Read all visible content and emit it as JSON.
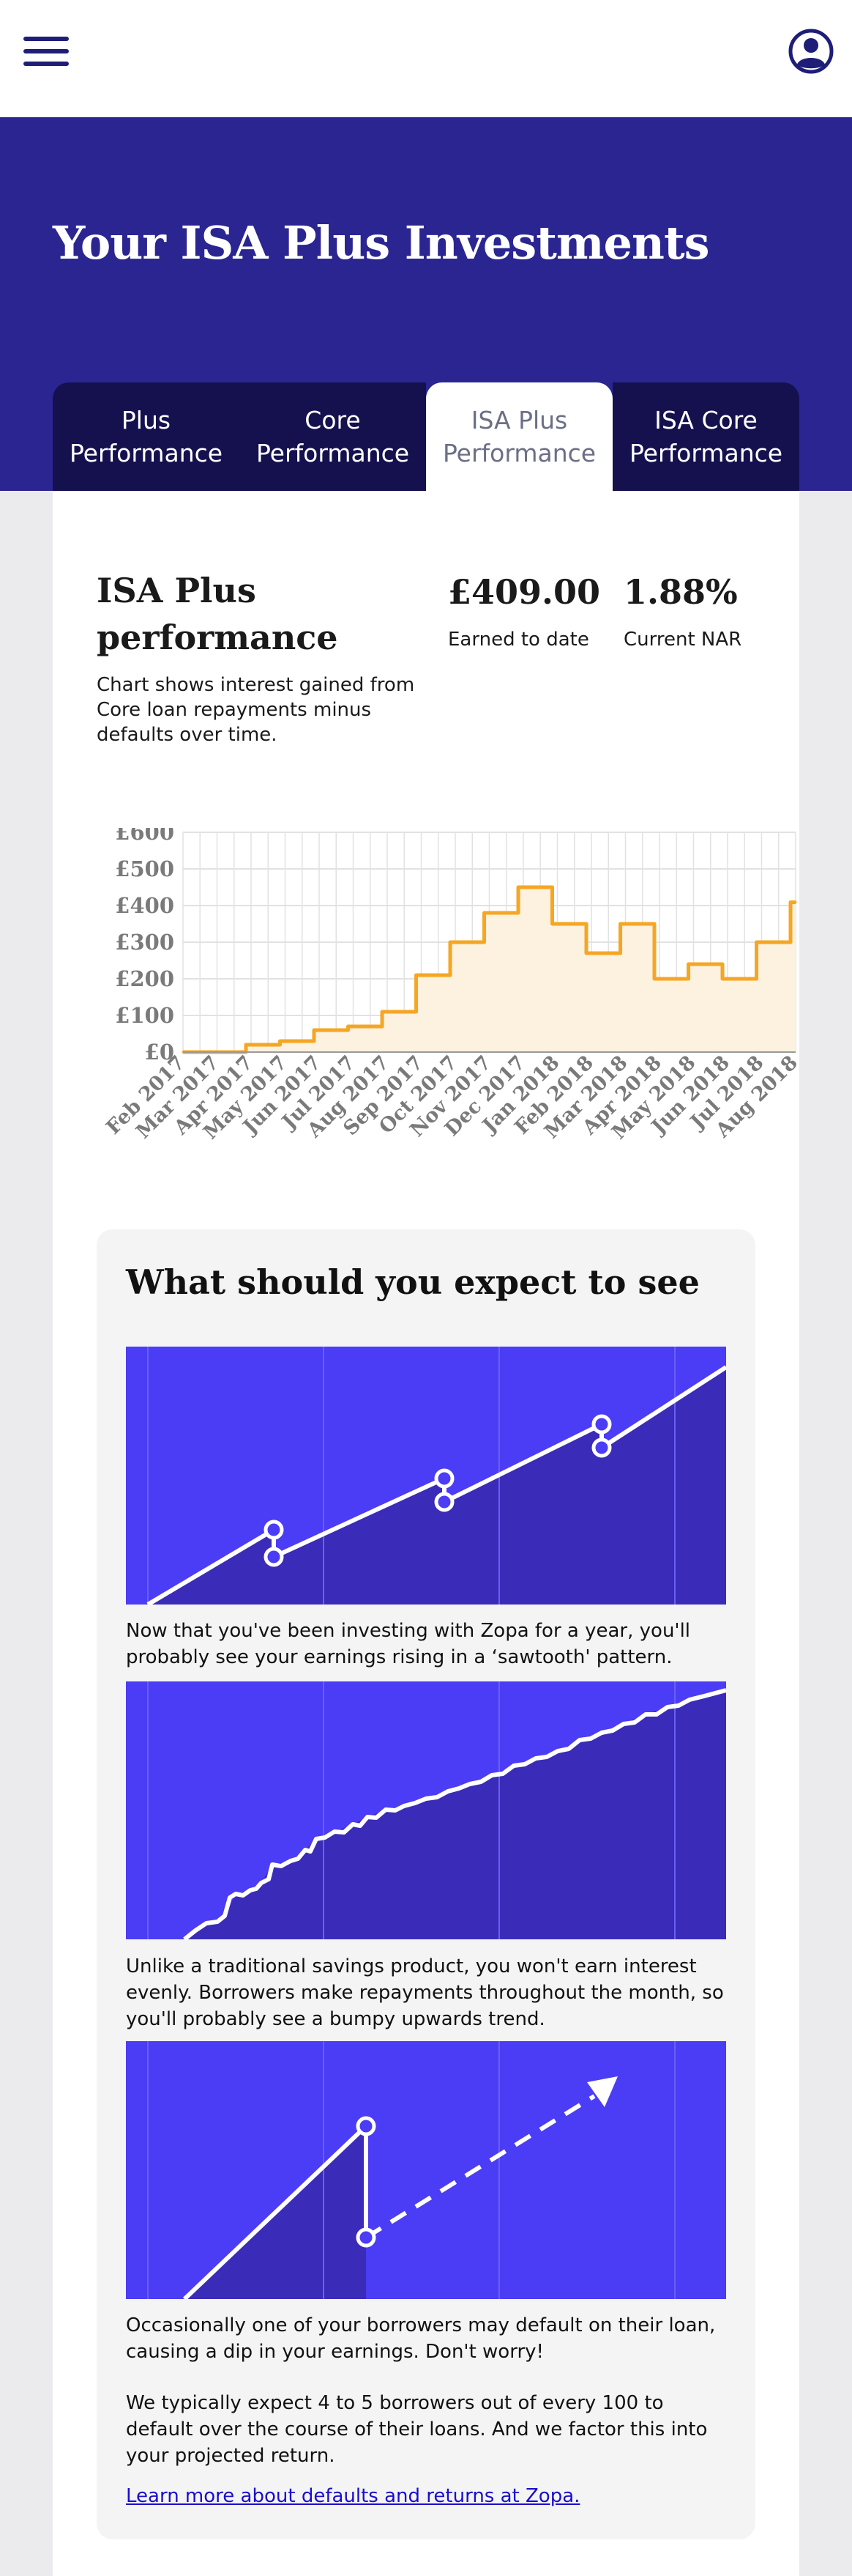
{
  "header": {
    "menu_icon": "hamburger-icon",
    "account_icon": "user-circle-icon"
  },
  "hero": {
    "title": "Your ISA Plus Investments"
  },
  "tabs": [
    {
      "label": "Plus\nPerformance",
      "active": false
    },
    {
      "label": "Core\nPerformance",
      "active": false
    },
    {
      "label": "ISA Plus\nPerformance",
      "active": true
    },
    {
      "label": "ISA Core\nPerformance",
      "active": false
    }
  ],
  "performance": {
    "title": "ISA Plus performance",
    "description": "Chart shows interest gained from Core loan repayments minus defaults over time.",
    "earned_value": "£409.00",
    "earned_label": "Earned to date",
    "nar_value": "1.88%",
    "nar_label": "Current NAR"
  },
  "chart_data": {
    "type": "area",
    "title": "",
    "xlabel": "",
    "ylabel": "",
    "ylim": [
      0,
      600
    ],
    "yticks": [
      "£0",
      "£100",
      "£200",
      "£300",
      "£400",
      "£500",
      "£600"
    ],
    "categories": [
      "Feb 2017",
      "Mar 2017",
      "Apr 2017",
      "May 2017",
      "Jun 2017",
      "Jul 2017",
      "Aug 2017",
      "Sep 2017",
      "Oct 2017",
      "Nov 2017",
      "Dec 2017",
      "Jan 2018",
      "Feb 2018",
      "Mar 2018",
      "Apr 2018",
      "May 2018",
      "Jun 2018",
      "Jul 2018",
      "Aug 2018"
    ],
    "series": [
      {
        "values": [
          0,
          0,
          20,
          30,
          60,
          70,
          110,
          210,
          300,
          380,
          450,
          350,
          270,
          350,
          200,
          240,
          200,
          300,
          409
        ]
      }
    ],
    "grid": true,
    "colors": {
      "line": "#f5a623",
      "fill": "#fdf1df"
    }
  },
  "expect": {
    "title": "What should you expect to see",
    "caption1": "Now that you've been investing with Zopa for a year, you'll probably see your earnings rising in a ‘sawtooth' pattern.",
    "caption2": "Unlike a traditional savings product, you won't earn interest evenly. Borrowers make repayments throughout the month, so you'll probably see a bumpy upwards trend.",
    "caption3a": "Occasionally one of your borrowers may default on their loan, causing a dip in your earnings. Don't worry!",
    "caption3b": "We typically expect 4 to 5 borrowers out of every 100 to default over the course of their loans. And we factor this into your projected return.",
    "learn_more": "Learn more about defaults and returns at Zopa."
  },
  "colors": {
    "brand": "#2b2592",
    "tab_dark": "#15114f",
    "illustration": "#4b3cf5",
    "illustration_dark": "#3a2bb8",
    "link": "#1a0dcc"
  }
}
